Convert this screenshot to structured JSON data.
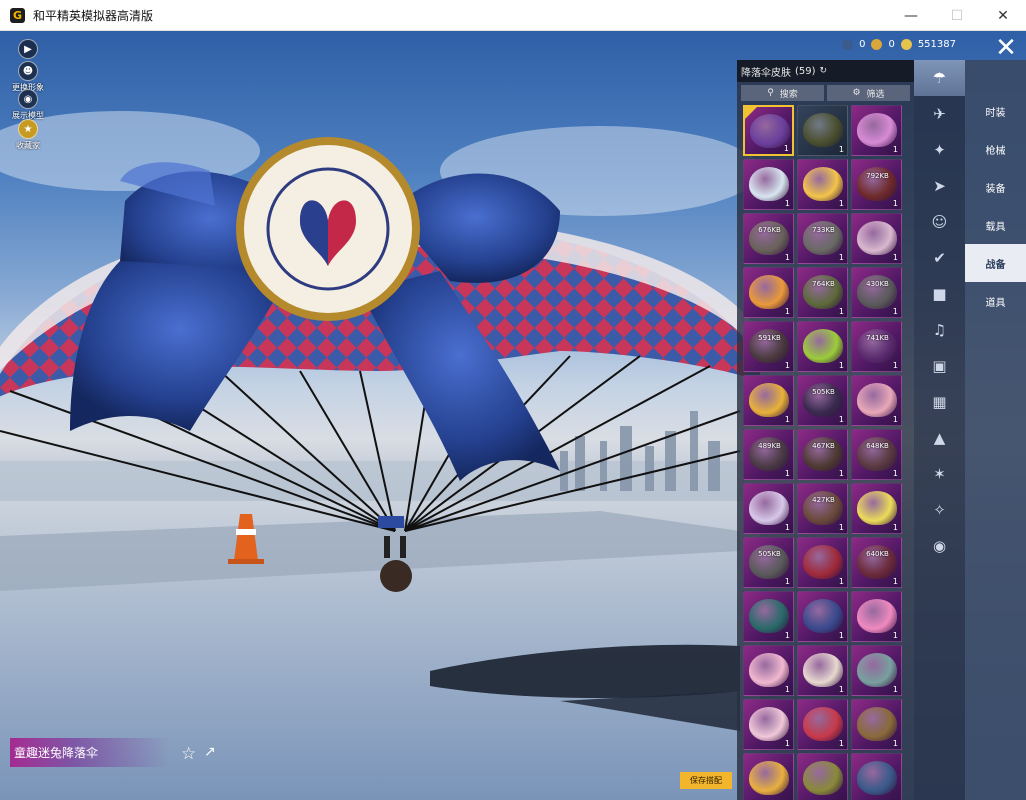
{
  "window": {
    "title": "和平精英模拟器高清版",
    "minimize_icon": "minimize-icon",
    "maximize_icon": "maximize-icon",
    "close_icon": "close-icon"
  },
  "left_tools": [
    {
      "label": "",
      "icon": "play-icon"
    },
    {
      "label": "更换形象",
      "icon": "character-icon"
    },
    {
      "label": "展示模型",
      "icon": "eye-icon"
    },
    {
      "label": "收藏家",
      "icon": "collector-icon"
    }
  ],
  "currency": {
    "values": [
      "0",
      "0",
      "551387"
    ],
    "colors": [
      "#3b5b8c",
      "#d8a63a",
      "#e6c34a"
    ]
  },
  "panel": {
    "title": "降落伞皮肤",
    "count": "(59)",
    "search_label": "搜索",
    "filter_label": "筛选",
    "items": [
      {
        "color": "#6b3f9c",
        "badge": "",
        "count": "1",
        "selected": true,
        "plain": false
      },
      {
        "color": "#4b4f2e",
        "badge": "",
        "count": "1",
        "selected": false,
        "plain": true
      },
      {
        "color": "#d88bd5",
        "badge": "",
        "count": "1",
        "selected": false,
        "plain": false
      },
      {
        "color": "#d8e6f0",
        "badge": "",
        "count": "1",
        "selected": false,
        "plain": false
      },
      {
        "color": "#f3c54a",
        "badge": "",
        "count": "1",
        "selected": false,
        "plain": false
      },
      {
        "color": "#6f2a2a",
        "badge": "792KB",
        "count": "1",
        "selected": false,
        "plain": false
      },
      {
        "color": "#6a625a",
        "badge": "676KB",
        "count": "1",
        "selected": false,
        "plain": false
      },
      {
        "color": "#6a6a64",
        "badge": "733KB",
        "count": "1",
        "selected": false,
        "plain": false
      },
      {
        "color": "#d9b8cf",
        "badge": "",
        "count": "1",
        "selected": false,
        "plain": false
      },
      {
        "color": "#ea9a3a",
        "badge": "",
        "count": "1",
        "selected": false,
        "plain": false
      },
      {
        "color": "#5d6a3a",
        "badge": "764KB",
        "count": "1",
        "selected": false,
        "plain": false
      },
      {
        "color": "#5a5a5a",
        "badge": "430KB",
        "count": "1",
        "selected": false,
        "plain": false
      },
      {
        "color": "#4a3a3e",
        "badge": "591KB",
        "count": "1",
        "selected": false,
        "plain": false
      },
      {
        "color": "#9ccc3a",
        "badge": "",
        "count": "1",
        "selected": false,
        "plain": false
      },
      {
        "color": "#5a2a6e",
        "badge": "741KB",
        "count": "1",
        "selected": false,
        "plain": false
      },
      {
        "color": "#e8b23a",
        "badge": "",
        "count": "1",
        "selected": false,
        "plain": false
      },
      {
        "color": "#3a2a4e",
        "badge": "505KB",
        "count": "1",
        "selected": false,
        "plain": false
      },
      {
        "color": "#e8a8b8",
        "badge": "",
        "count": "1",
        "selected": false,
        "plain": false
      },
      {
        "color": "#4a3a44",
        "badge": "489KB",
        "count": "1",
        "selected": false,
        "plain": false
      },
      {
        "color": "#4e3a32",
        "badge": "467KB",
        "count": "1",
        "selected": false,
        "plain": false
      },
      {
        "color": "#5a3a40",
        "badge": "648KB",
        "count": "1",
        "selected": false,
        "plain": false
      },
      {
        "color": "#d8c8e8",
        "badge": "",
        "count": "1",
        "selected": false,
        "plain": false
      },
      {
        "color": "#6a4a3a",
        "badge": "427KB",
        "count": "1",
        "selected": false,
        "plain": false
      },
      {
        "color": "#ecdc5a",
        "badge": "",
        "count": "1",
        "selected": false,
        "plain": false
      },
      {
        "color": "#5a5a5a",
        "badge": "505KB",
        "count": "1",
        "selected": false,
        "plain": false
      },
      {
        "color": "#a02a3a",
        "badge": "",
        "count": "1",
        "selected": false,
        "plain": false
      },
      {
        "color": "#6a2a3a",
        "badge": "640KB",
        "count": "1",
        "selected": false,
        "plain": false
      },
      {
        "color": "#2a6a6a",
        "badge": "",
        "count": "1",
        "selected": false,
        "plain": false
      },
      {
        "color": "#3a4a8e",
        "badge": "",
        "count": "1",
        "selected": false,
        "plain": false
      },
      {
        "color": "#f08ac0",
        "badge": "",
        "count": "1",
        "selected": false,
        "plain": false
      },
      {
        "color": "#f2b8d0",
        "badge": "",
        "count": "1",
        "selected": false,
        "plain": false
      },
      {
        "color": "#e8d8d0",
        "badge": "",
        "count": "1",
        "selected": false,
        "plain": false
      },
      {
        "color": "#7aa0a0",
        "badge": "",
        "count": "1",
        "selected": false,
        "plain": false
      },
      {
        "color": "#f0c8d8",
        "badge": "",
        "count": "1",
        "selected": false,
        "plain": false
      },
      {
        "color": "#c83a4a",
        "badge": "",
        "count": "1",
        "selected": false,
        "plain": false
      },
      {
        "color": "#8a6a3a",
        "badge": "",
        "count": "1",
        "selected": false,
        "plain": false
      },
      {
        "color": "#e8b040",
        "badge": "",
        "count": "",
        "selected": false,
        "plain": false
      },
      {
        "color": "#8a8a3a",
        "badge": "",
        "count": "",
        "selected": false,
        "plain": false
      },
      {
        "color": "#3a5a8a",
        "badge": "",
        "count": "",
        "selected": false,
        "plain": false
      }
    ]
  },
  "icon_column": [
    {
      "icon": "parachute-icon",
      "active": true
    },
    {
      "icon": "plane-icon",
      "active": false
    },
    {
      "icon": "drone-icon",
      "active": false
    },
    {
      "icon": "jet-icon",
      "active": false
    },
    {
      "icon": "emote-face-icon",
      "active": false
    },
    {
      "icon": "glider-icon",
      "active": false
    },
    {
      "icon": "robot-icon",
      "active": false
    },
    {
      "icon": "sound-icon",
      "active": false
    },
    {
      "icon": "card-icon",
      "active": false
    },
    {
      "icon": "picture-icon",
      "active": false
    },
    {
      "icon": "spray-icon",
      "active": false
    },
    {
      "icon": "sparkle-icon",
      "active": false
    },
    {
      "icon": "wand-icon",
      "active": false
    },
    {
      "icon": "helmet-icon",
      "active": false
    }
  ],
  "categories": [
    {
      "label": "时装",
      "active": false
    },
    {
      "label": "枪械",
      "active": false
    },
    {
      "label": "装备",
      "active": false
    },
    {
      "label": "载具",
      "active": false
    },
    {
      "label": "战备",
      "active": true
    },
    {
      "label": "道具",
      "active": false
    }
  ],
  "selected_item_name": "童趣迷兔降落伞",
  "save_label": "保存搭配"
}
